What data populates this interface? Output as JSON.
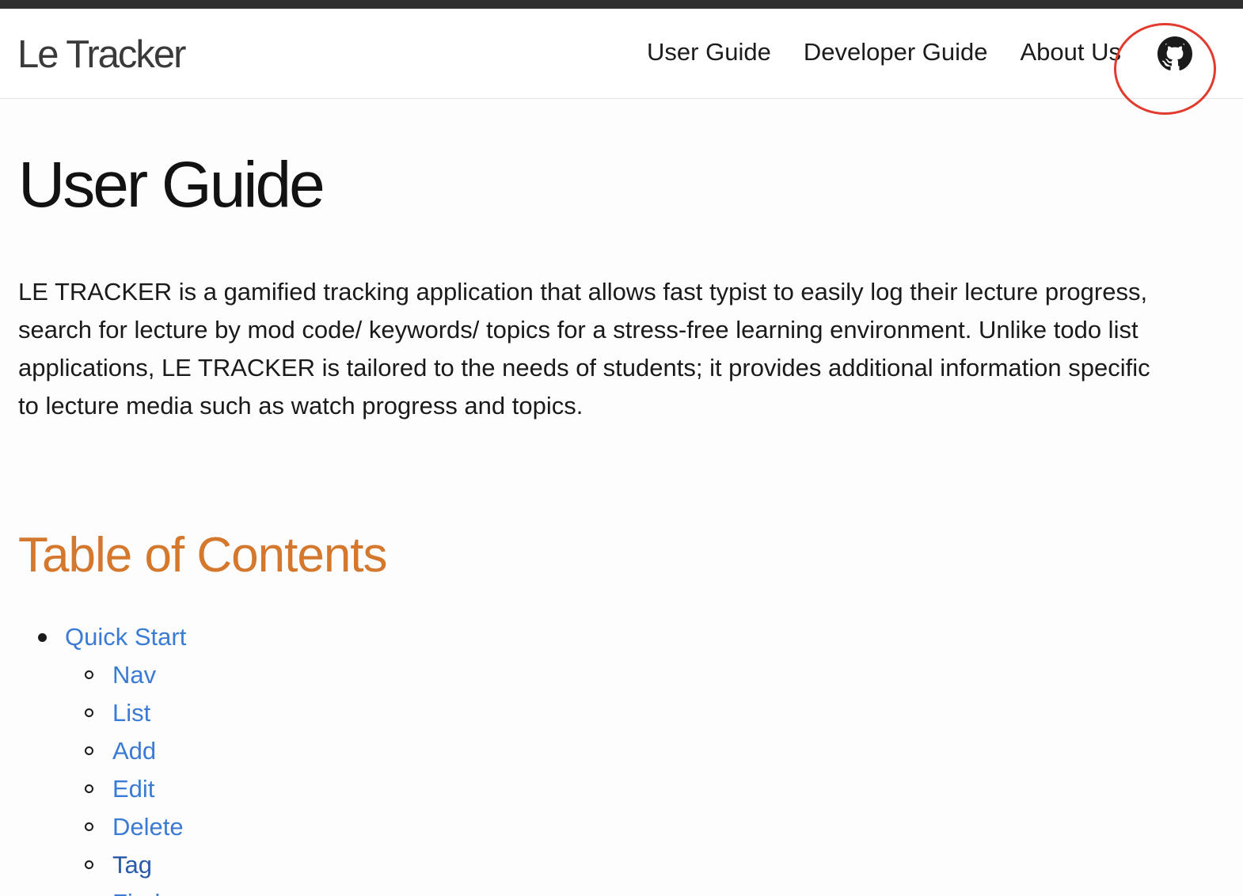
{
  "navbar": {
    "brand": "Le Tracker",
    "links": [
      "User Guide",
      "Developer Guide",
      "About Us"
    ],
    "github_icon": "github-icon"
  },
  "page": {
    "title": "User Guide",
    "intro": "LE TRACKER is a gamified tracking application that allows fast typist to easily log their lecture progress, search for lecture by mod code/ keywords/ topics for a stress-free learning environment. Unlike todo list applications, LE TRACKER is tailored to the needs of students; it provides additional information specific to lecture media such as watch progress and topics."
  },
  "toc": {
    "heading": "Table of Contents",
    "items": [
      {
        "label": "Quick Start",
        "children": [
          "Nav",
          "List",
          "Add",
          "Edit",
          "Delete",
          "Tag",
          "Find"
        ]
      }
    ]
  },
  "colors": {
    "accent_heading": "#d4782e",
    "link": "#3b7bd4",
    "annotation_ring": "#e23b2e"
  }
}
